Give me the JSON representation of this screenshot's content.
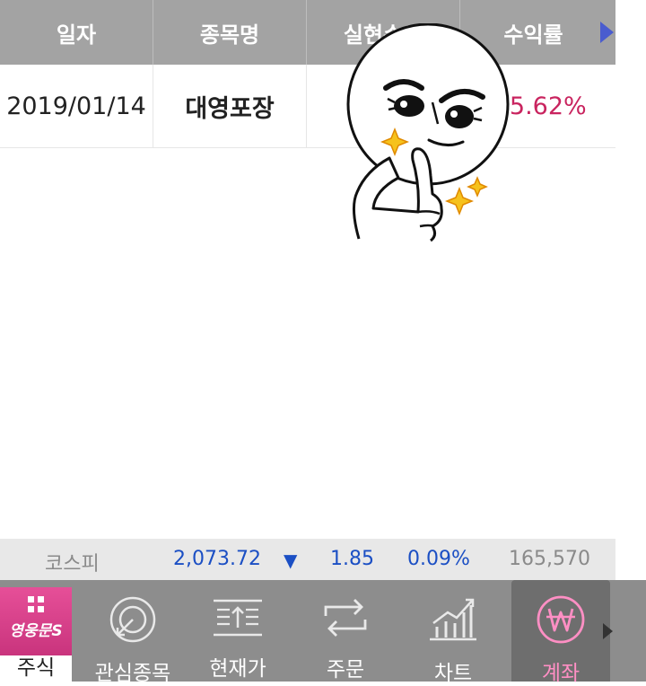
{
  "table": {
    "headers": [
      "일자",
      "종목명",
      "실현손익",
      "수익률"
    ],
    "row": {
      "date": "2019/01/14",
      "name": "대영포장",
      "profit": "",
      "rate": "+5.62%"
    }
  },
  "index_bar": {
    "label": "코스피",
    "value": "2,073.72",
    "arrow": "▼",
    "change": "1.85",
    "percent": "0.09%",
    "volume": "165,570"
  },
  "nav": {
    "stock_logo": "영웅문S",
    "items": [
      {
        "label": "주식",
        "icon": "grid-icon"
      },
      {
        "label": "관심종목",
        "icon": "target-icon"
      },
      {
        "label": "현재가",
        "icon": "price-list-icon"
      },
      {
        "label": "주문",
        "icon": "exchange-arrows-icon"
      },
      {
        "label": "차트",
        "icon": "chart-icon"
      },
      {
        "label": "계좌",
        "icon": "won-icon"
      }
    ]
  },
  "colors": {
    "header_bg": "#a3a3a3",
    "rate_positive": "#c9245f",
    "index_blue": "#1b4fc4",
    "nav_bg": "#8d8d8d",
    "nav_active_label": "#ff8fc4",
    "brand_pink": "#e64f98"
  }
}
